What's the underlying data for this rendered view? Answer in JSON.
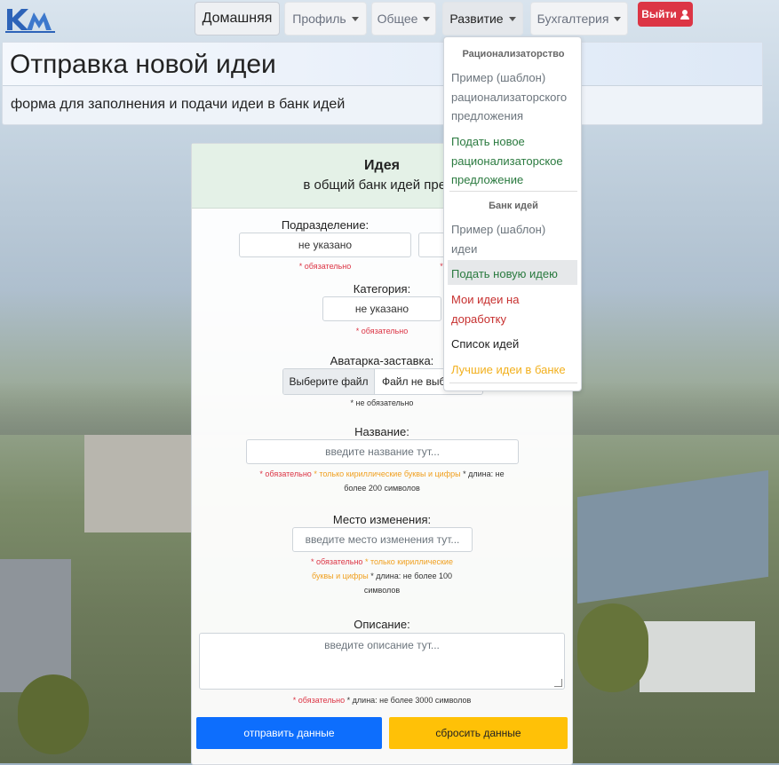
{
  "navbar": {
    "home": "Домашняя",
    "profile": "Профиль",
    "general": "Общее",
    "development": "Развитие",
    "accounting": "Бухгалтерия",
    "logout": "Выйти",
    "logo_icon": "company-logo-icon",
    "logout_icon": "user-icon"
  },
  "header": {
    "title": "Отправка новой идеи",
    "subtitle": "форма для заполнения и подачи идеи в банк идей"
  },
  "form": {
    "heading": "Идея",
    "subheading": "в общий банк идей предп",
    "division": {
      "label": "Подразделение:",
      "value1": "не указано",
      "required1": "* обязательно",
      "required2": "*"
    },
    "category": {
      "label": "Категория:",
      "value": "не указано",
      "required": "* обязательно"
    },
    "avatar": {
      "label": "Аватарка-заставка:",
      "button": "Выберите файл",
      "file_text": "Файл не выб",
      "hint": "* не обязательно"
    },
    "name": {
      "label": "Название:",
      "placeholder": "введите название тут...",
      "req": "* обязательно",
      "cyr": "* только кириллические буквы и цифры",
      "len1": "* длина: не",
      "len2": "более 200 символов"
    },
    "place": {
      "label": "Место изменения:",
      "placeholder": "введите место изменения тут...",
      "req": "* обязательно",
      "cyr1": "* только кириллические",
      "cyr2": "буквы и цифры",
      "len1": "* длина: не более 100",
      "len2": "символов"
    },
    "description": {
      "label": "Описание:",
      "placeholder": "введите описание тут...",
      "req": "* обязательно",
      "len": "* длина: не более 3000 символов"
    },
    "submit": "отправить данные",
    "reset": "сбросить данные"
  },
  "dropdown": {
    "section1": "Рационализаторство",
    "item1": [
      "Пример (шаблон)",
      "рационализаторского",
      "предложения"
    ],
    "item2": [
      "Подать новое",
      "рационализаторское",
      "предложение"
    ],
    "section2": "Банк идей",
    "item3": [
      "Пример (шаблон)",
      "идеи"
    ],
    "item4": "Подать новую идею",
    "item5": [
      "Мои идеи на",
      "доработку"
    ],
    "item6": "Список идей",
    "item7": "Лучшие идеи в банке"
  },
  "colors": {
    "primary": "#0d6efd",
    "warning": "#ffc107",
    "danger": "#dc3545",
    "success": "#2a7a3f"
  }
}
